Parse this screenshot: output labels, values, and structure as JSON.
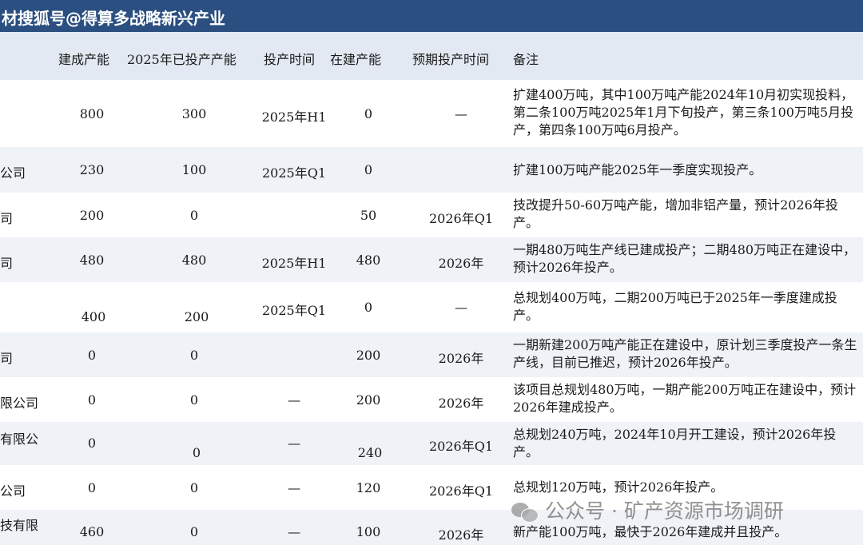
{
  "title": "确认搜狐号@得算多战略新兴产业",
  "title_display": "材搜狐号@得算多战略新兴产业",
  "columns": [
    "建成产能",
    "2025年已投产产能",
    "投产时间",
    "在建产能",
    "预期投产时间",
    "备注"
  ],
  "rows": [
    {
      "name": "",
      "built": "800",
      "produced": "300",
      "time": "2025年H1",
      "building": "0",
      "expected": "—",
      "note": "扩建400万吨，其中100万吨产能2024年10月初实现投料，第二条100万吨2025年1月下旬投产，第三条100万吨5月投产，第四条100万吨6月投产。"
    },
    {
      "name": "公司",
      "built": "230",
      "produced": "100",
      "time": "2025年Q1",
      "building": "0",
      "expected": "",
      "note": "扩建100万吨产能2025年一季度实现投产。"
    },
    {
      "name": "司",
      "built": "200",
      "produced": "0",
      "time": "",
      "building": "50",
      "expected": "2026年Q1",
      "note": "技改提升50-60万吨产能，增加非铝产量，预计2026年投产。"
    },
    {
      "name": "司",
      "built": "480",
      "produced": "480",
      "time": "2025年H1",
      "building": "480",
      "expected": "2026年",
      "note": "一期480万吨生产线已建成投产；二期480万吨正在建设中，预计2026年投产。"
    },
    {
      "name": "",
      "built": "400",
      "produced": "200",
      "time": "2025年Q1",
      "building": "0",
      "expected": "—",
      "note": "总规划400万吨，二期200万吨已于2025年一季度建成投产。"
    },
    {
      "name": "司",
      "built": "0",
      "produced": "0",
      "time": "",
      "building": "200",
      "expected": "2026年",
      "note": "一期新建200万吨产能正在建设中，原计划三季度投产一条生产线，目前已推迟，预计2026年投产。"
    },
    {
      "name": "限公司",
      "built": "0",
      "produced": "0",
      "time": "—",
      "building": "200",
      "expected": "2026年",
      "note": "该项目总规划480万吨，一期产能200万吨正在建设中，预计2026年建成投产。"
    },
    {
      "name": "有限公",
      "built": "0",
      "produced": "0",
      "time": "—",
      "building": "240",
      "expected": "2026年Q1",
      "note": "总规划240万吨，2024年10月开工建设，预计2026年投产。"
    },
    {
      "name": "公司",
      "built": "0",
      "produced": "0",
      "time": "—",
      "building": "120",
      "expected": "2026年Q1",
      "note": "总规划120万吨，预计2026年投产。"
    },
    {
      "name": "技有限",
      "built": "460",
      "produced": "0",
      "time": "—",
      "building": "100",
      "expected": "2026年",
      "note": "新产能100万吨，最快于2026年建成并且投产。"
    }
  ],
  "watermark": "公众号 · 矿产资源市场调研",
  "colors": {
    "title_bar": "#2b4f80",
    "header_bg": "#e3e9f2",
    "row_shade": "#eff2f7"
  }
}
